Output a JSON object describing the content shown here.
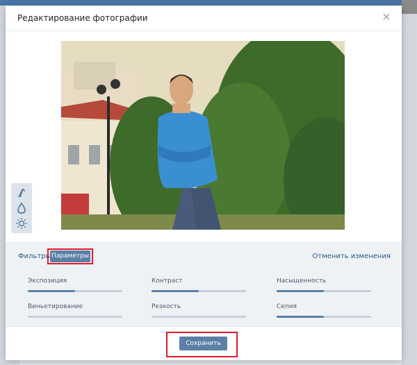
{
  "modal": {
    "title": "Редактирование фотографии"
  },
  "editor": {
    "photo_subject": "photo",
    "tools": [
      {
        "icon": "text-tool-icon"
      },
      {
        "icon": "drop-icon"
      },
      {
        "icon": "brightness-icon"
      }
    ]
  },
  "panel": {
    "tabs": [
      {
        "label": "Фильтры",
        "active": false
      },
      {
        "label": "Параметры",
        "active": true
      }
    ],
    "reset_label": "Отменить изменения",
    "sliders": [
      {
        "label": "Экспозиция",
        "value": 0.5
      },
      {
        "label": "Контраст",
        "value": 0.5
      },
      {
        "label": "Насыщенность",
        "value": 0.5
      },
      {
        "label": "Виньетирование",
        "value": 0
      },
      {
        "label": "Резкость",
        "value": 0
      },
      {
        "label": "Сепия",
        "value": 0.5
      }
    ]
  },
  "footer": {
    "save_label": "Сохранить"
  },
  "colors": {
    "accent": "#5b7fa6",
    "link": "#2a5885",
    "highlight": "#e2192c"
  }
}
